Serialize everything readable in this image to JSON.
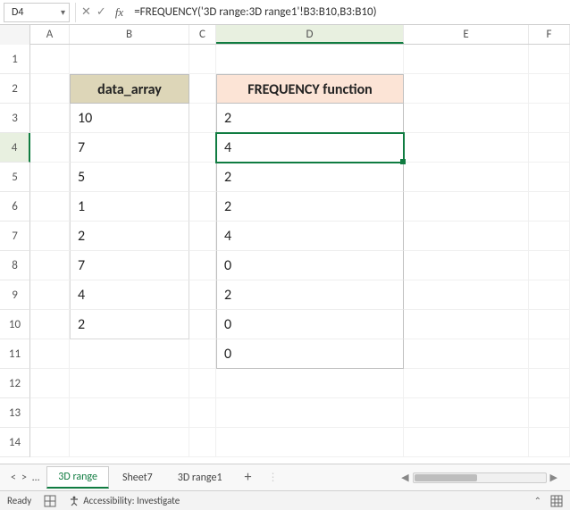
{
  "formula_bar": {
    "cell_ref": "D4",
    "formula": "=FREQUENCY('3D range:3D range1'!B3:B10,B3:B10)"
  },
  "columns": [
    "A",
    "B",
    "C",
    "D",
    "E",
    "F"
  ],
  "selected_col": "D",
  "selected_row": 4,
  "headers": {
    "B2": "data_array",
    "D2": "FREQUENCY function"
  },
  "data_B": [
    "10",
    "7",
    "5",
    "1",
    "2",
    "7",
    "4",
    "2"
  ],
  "data_D": [
    "2",
    "4",
    "2",
    "2",
    "4",
    "0",
    "2",
    "0",
    "0"
  ],
  "tabs": {
    "items": [
      "3D range",
      "Sheet7",
      "3D range1"
    ],
    "active": 0
  },
  "status": {
    "ready": "Ready",
    "accessibility": "Accessibility: Investigate"
  }
}
